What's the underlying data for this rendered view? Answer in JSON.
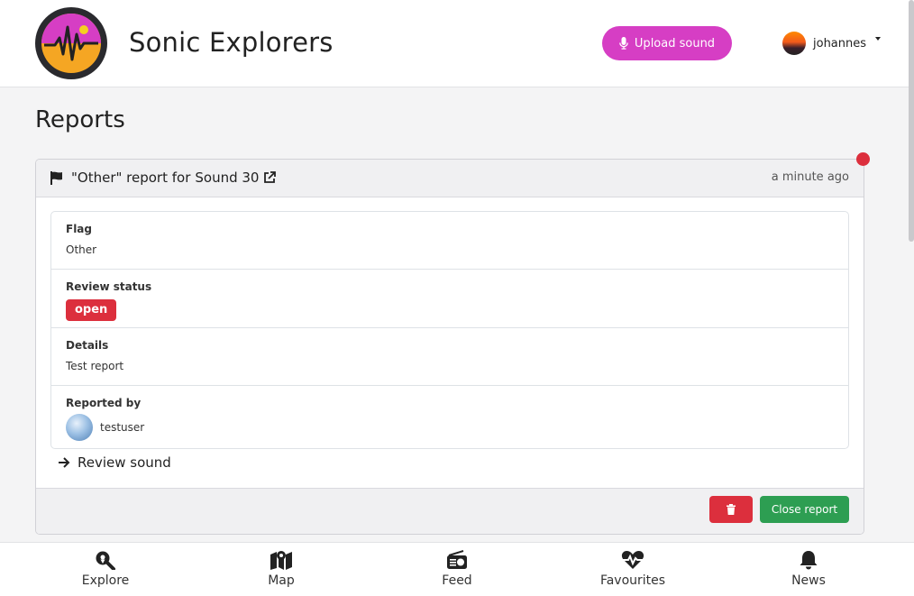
{
  "header": {
    "brand": "Sonic Explorers",
    "upload_label": "Upload sound",
    "username": "johannes"
  },
  "page": {
    "title": "Reports"
  },
  "report": {
    "title_prefix": "\"Other\" report for",
    "sound_link": "Sound 30",
    "time_ago": "a minute ago",
    "fields": {
      "flag_label": "Flag",
      "flag_value": "Other",
      "status_label": "Review status",
      "status_value": "open",
      "details_label": "Details",
      "details_value": "Test report",
      "reporter_label": "Reported by",
      "reporter_value": "testuser"
    },
    "review_link": "Review sound",
    "close_label": "Close report"
  },
  "bottom_nav": {
    "items": [
      {
        "label": "Explore",
        "icon": "search-location-icon"
      },
      {
        "label": "Map",
        "icon": "map-icon"
      },
      {
        "label": "Feed",
        "icon": "radio-icon"
      },
      {
        "label": "Favourites",
        "icon": "heartbeat-icon"
      },
      {
        "label": "News",
        "icon": "bell-icon"
      }
    ]
  },
  "colors": {
    "brand_pink": "#d63ec4",
    "danger": "#dc2f3d",
    "success": "#2d9e52"
  }
}
